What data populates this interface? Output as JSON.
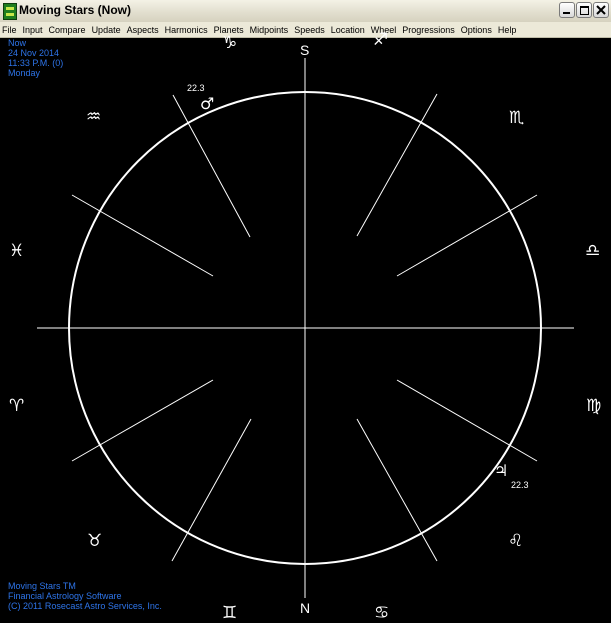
{
  "window": {
    "title": "Moving Stars (Now)"
  },
  "menu": [
    "File",
    "Input",
    "Compare",
    "Update",
    "Aspects",
    "Harmonics",
    "Planets",
    "Midpoints",
    "Speeds",
    "Location",
    "Wheel",
    "Progressions",
    "Options",
    "Help"
  ],
  "info": {
    "mode": "Now",
    "date": "24 Nov 2014",
    "time": "11:33 P.M. (0)",
    "weekday": "Monday"
  },
  "footer": {
    "line1": "Moving Stars TM",
    "line2": "Financial Astrology Software",
    "line3": "(C) 2011 Rosecast Astro Services, Inc."
  },
  "compass": {
    "top": "S",
    "bottom": "N"
  },
  "zodiac_glyphs": {
    "top_left_partial": "♑",
    "top_right_partial": "♐",
    "aquarius": "♒",
    "scorpio": "♏",
    "pisces": "♓",
    "libra": "♎",
    "aries": "♈",
    "virgo": "♍",
    "taurus": "♉",
    "leo": "♌",
    "bottom_left_partial": "♊",
    "bottom_right_partial": "♋"
  },
  "planets": {
    "mars": {
      "glyph": "♂",
      "degree": "22.3"
    },
    "jupiter": {
      "glyph": "♃",
      "degree": "22.3"
    }
  },
  "colors": {
    "background": "#000000",
    "wheel": "#ffffff",
    "info_text": "#2e74e8",
    "menubar": "#ece9d8"
  }
}
